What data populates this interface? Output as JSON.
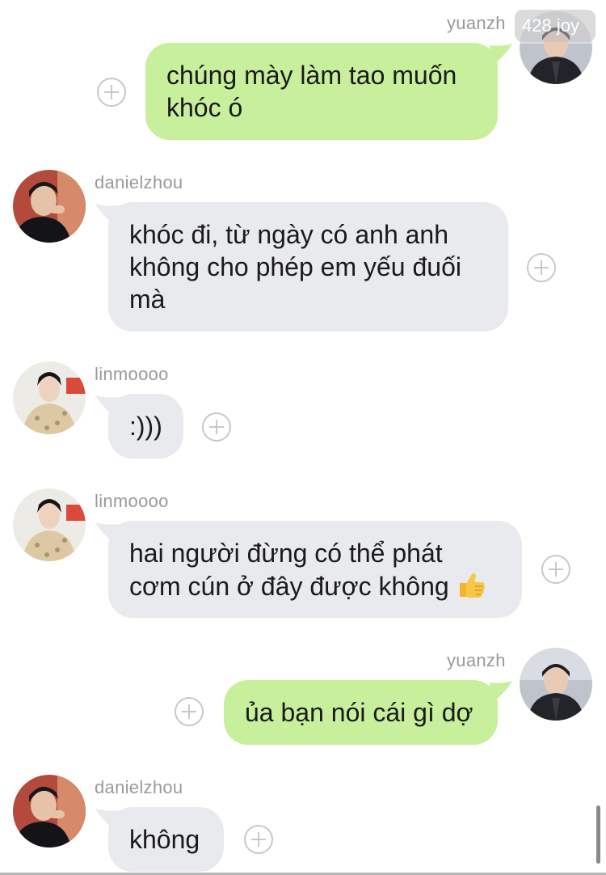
{
  "watermark": "428 joy",
  "messages": [
    {
      "sender": "yuanzh",
      "side": "out",
      "lines": [
        "chúng mày làm tao muốn",
        "khóc ó"
      ]
    },
    {
      "sender": "danielzhou",
      "side": "in",
      "lines": [
        "khóc đi, từ ngày có anh anh",
        "không cho phép em yếu đuối",
        "mà"
      ]
    },
    {
      "sender": "linmoooo",
      "side": "in",
      "lines": [
        ":)))"
      ]
    },
    {
      "sender": "linmoooo",
      "side": "in",
      "lines": [
        "hai người đừng có thể phát",
        "cơm cún ở đây được không"
      ],
      "emoji": "thumbs-up"
    },
    {
      "sender": "yuanzh",
      "side": "out",
      "lines": [
        "ủa bạn nói cái gì dợ"
      ]
    },
    {
      "sender": "danielzhou",
      "side": "in",
      "lines": [
        "không"
      ]
    }
  ],
  "colors": {
    "incoming_bubble": "#e8eaed",
    "outgoing_bubble": "#c8ef9b",
    "sender_name": "#9a9a9a"
  }
}
